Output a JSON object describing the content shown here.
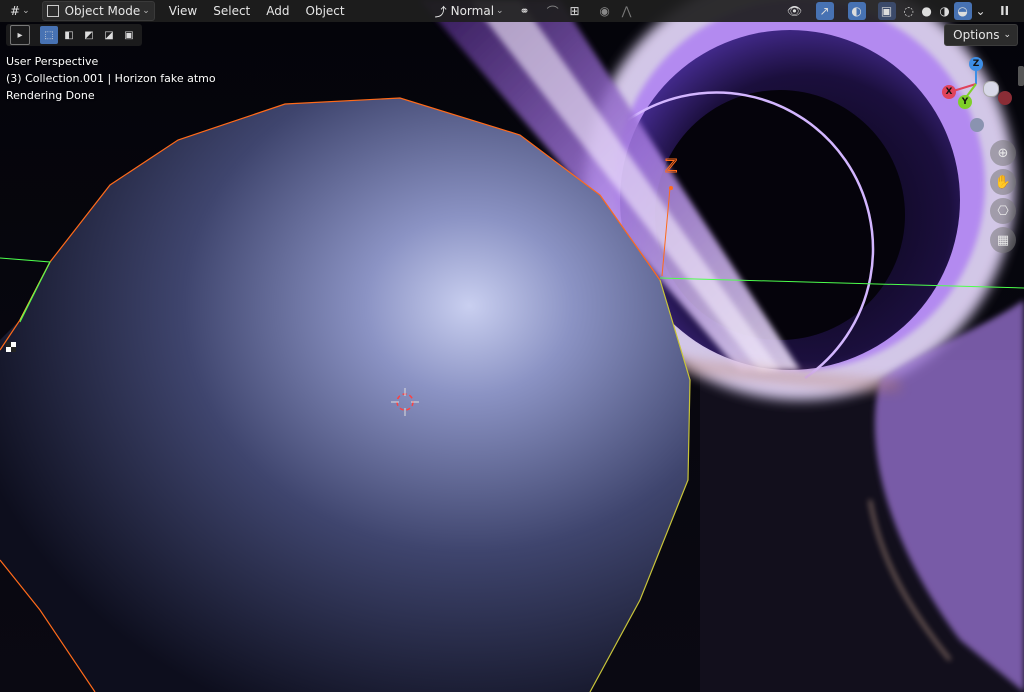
{
  "header": {
    "editor_icon": "#",
    "mode_label": "Object Mode",
    "menus": [
      "View",
      "Select",
      "Add",
      "Object"
    ],
    "transform_orientation": "Normal",
    "pause_icon": "II"
  },
  "viewport_info": {
    "line1": "User Perspective",
    "line2": "(3) Collection.001 | Horizon fake atmo",
    "line3": "Rendering Done"
  },
  "options_label": "Options",
  "gizmo": {
    "z_label": "Z",
    "x_label": "X",
    "y_label": "Y",
    "empty_label": "Z"
  },
  "colors": {
    "header_bg": "#1e1e1e",
    "active_blue": "#4772b3",
    "axis_x": "#e0435b",
    "axis_y": "#7fcf2a",
    "axis_z": "#3d8ee6",
    "selection_orange": "#ff6a1a",
    "selection_yellow": "#c8c43a",
    "light_green": "#4dff4d"
  },
  "icons": [
    "cursor-tool-icon",
    "select-box-icon",
    "visibility-icon",
    "gizmo-icon",
    "overlay-icon",
    "wireframe-shading-icon",
    "solid-shading-icon",
    "material-shading-icon",
    "rendered-shading-icon",
    "zoom-icon",
    "hand-icon",
    "camera-icon",
    "grid-icon",
    "pause-icon"
  ]
}
